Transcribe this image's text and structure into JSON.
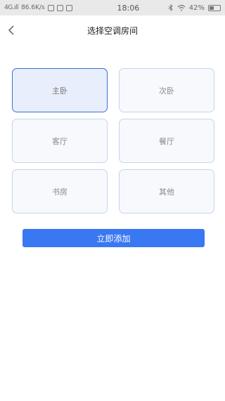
{
  "status_bar": {
    "signal": "4G.ıll",
    "net_speed": "86.6K/s",
    "time": "18:06",
    "battery_percent": "42%",
    "battery_level": 0.42
  },
  "header": {
    "back_icon": "chevron-left-icon",
    "title": "选择空调房间"
  },
  "rooms": [
    {
      "label": "主卧",
      "selected": true
    },
    {
      "label": "次卧",
      "selected": false
    },
    {
      "label": "客厅",
      "selected": false
    },
    {
      "label": "餐厅",
      "selected": false
    },
    {
      "label": "书房",
      "selected": false
    },
    {
      "label": "其他",
      "selected": false
    }
  ],
  "actions": {
    "add_label": "立即添加"
  },
  "colors": {
    "accent": "#3a77f2",
    "selected_border": "#3b70d6",
    "selected_bg": "#e8eefb",
    "card_border": "#c5d4ee"
  }
}
